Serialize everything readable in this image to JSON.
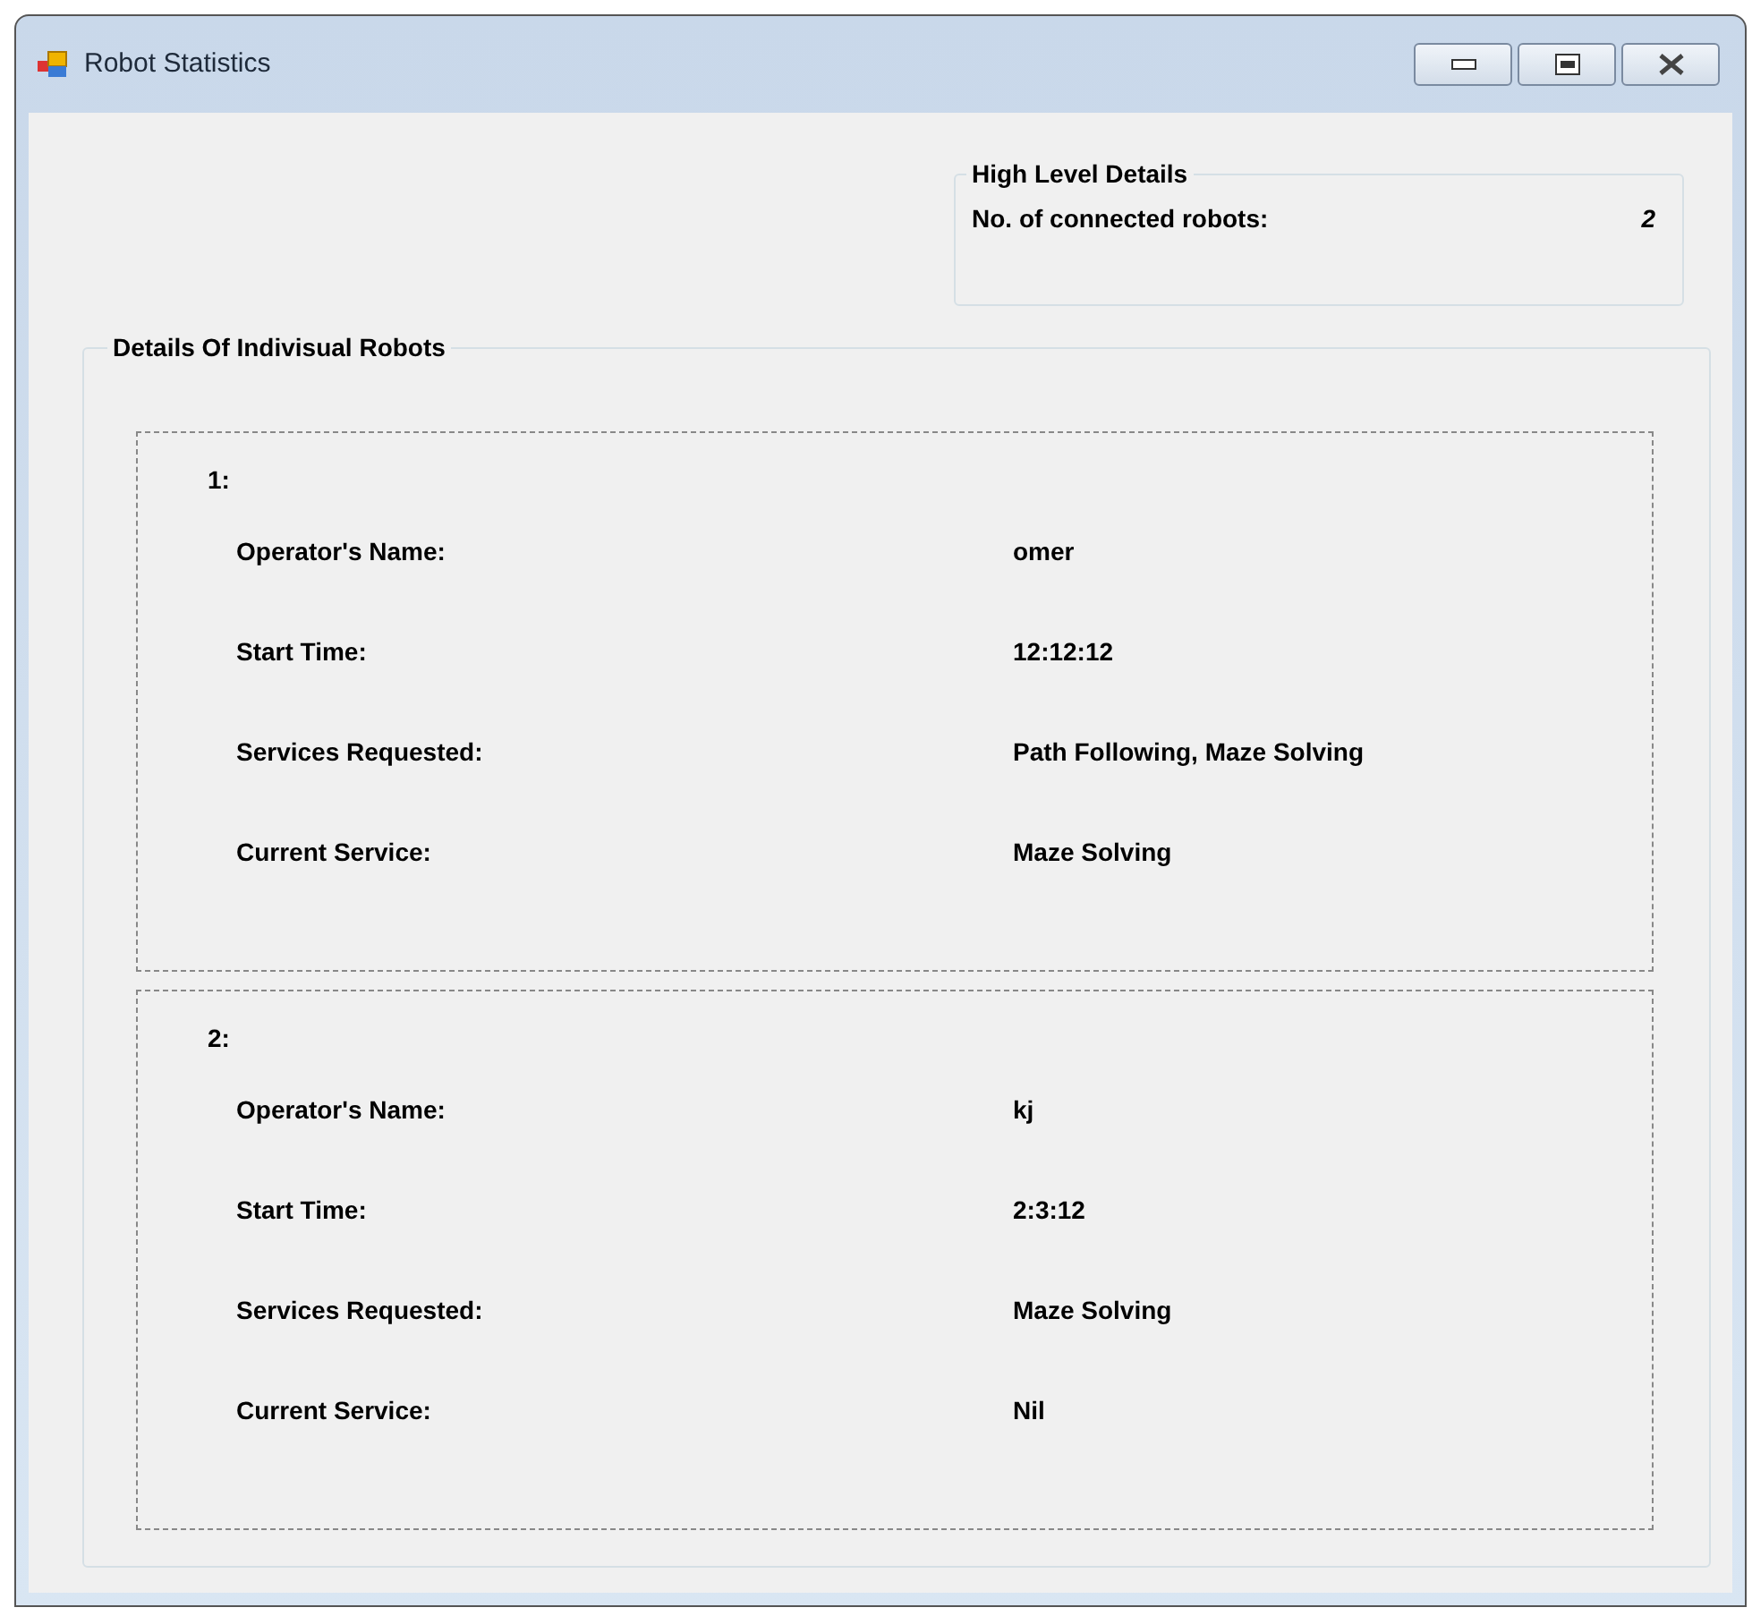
{
  "window": {
    "title": "Robot Statistics"
  },
  "high_level": {
    "title": "High Level Details",
    "label": "No. of connected robots:",
    "value": "2"
  },
  "details": {
    "title": "Details Of Indivisual Robots",
    "robots": [
      {
        "index": "1:",
        "fields": [
          {
            "label": "Operator's Name:",
            "value": "omer"
          },
          {
            "label": "Start Time:",
            "value": "12:12:12"
          },
          {
            "label": "Services Requested:",
            "value": "Path Following, Maze Solving"
          },
          {
            "label": "Current Service:",
            "value": "Maze Solving"
          }
        ]
      },
      {
        "index": "2:",
        "fields": [
          {
            "label": "Operator's Name:",
            "value": "kj"
          },
          {
            "label": "Start Time:",
            "value": "2:3:12"
          },
          {
            "label": "Services Requested:",
            "value": "Maze Solving"
          },
          {
            "label": "Current Service:",
            "value": "Nil"
          }
        ]
      }
    ]
  }
}
